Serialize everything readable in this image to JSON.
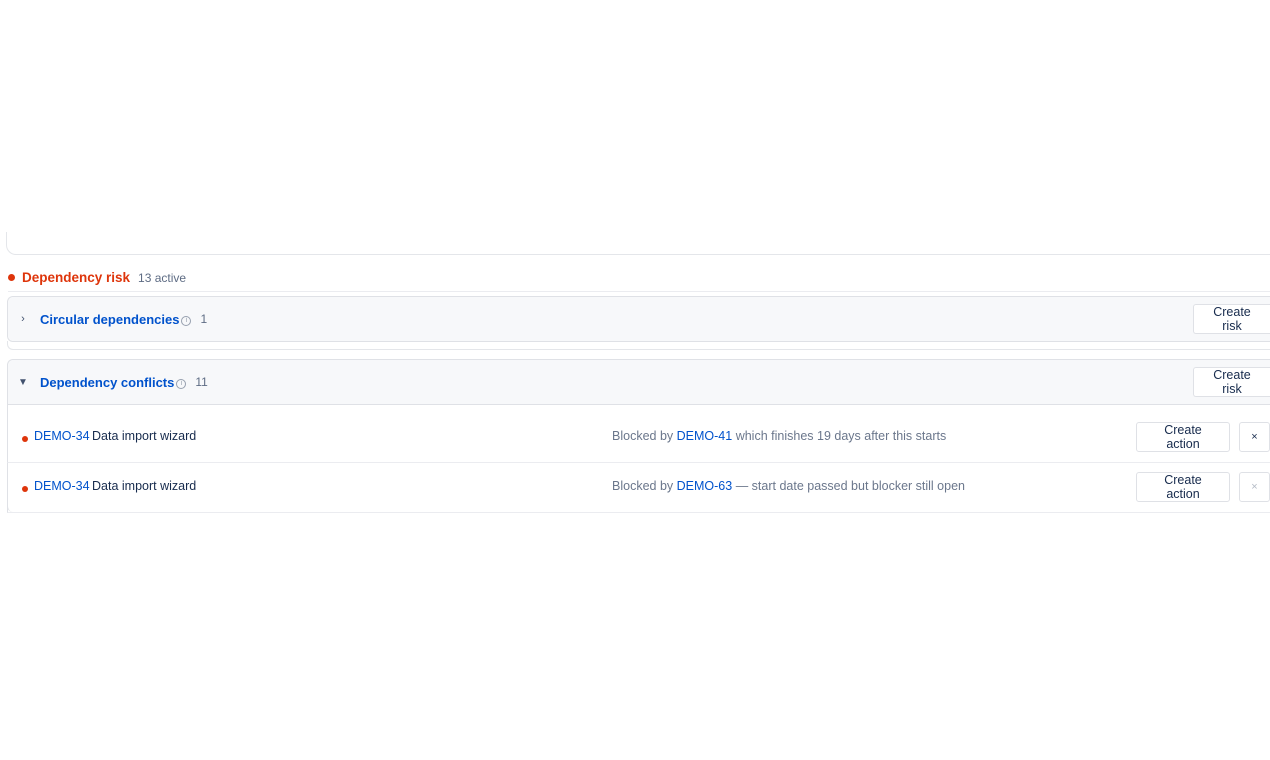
{
  "risk_section": {
    "title": "Dependency risk",
    "count": "13 active"
  },
  "groups": [
    {
      "title": "Circular dependencies",
      "count": "1",
      "expanded": false,
      "chevron": "›",
      "action_label": "Create risk"
    },
    {
      "title": "Dependency conflicts",
      "count": "11",
      "expanded": true,
      "chevron": "▼",
      "action_label": "Create risk",
      "rows": [
        {
          "key": "DEMO-34",
          "title": "Data import wizard",
          "reason_prefix": "Blocked by",
          "blocker": "DEMO-41",
          "reason_suffix": "which finishes 19 days after this starts",
          "action_label": "Create action",
          "dismiss_label": "×"
        },
        {
          "key": "DEMO-34",
          "title": "Data import wizard",
          "reason_prefix": "Blocked by",
          "blocker": "DEMO-63",
          "reason_suffix": "— start date passed but blocker still open",
          "action_label": "Create action",
          "dismiss_label": "×"
        }
      ]
    }
  ],
  "icons": {
    "info": "info-icon",
    "status_dot_color": "#de350b"
  },
  "colors": {
    "link": "#0052cc",
    "risk": "#de350b",
    "muted": "#6b778c"
  }
}
